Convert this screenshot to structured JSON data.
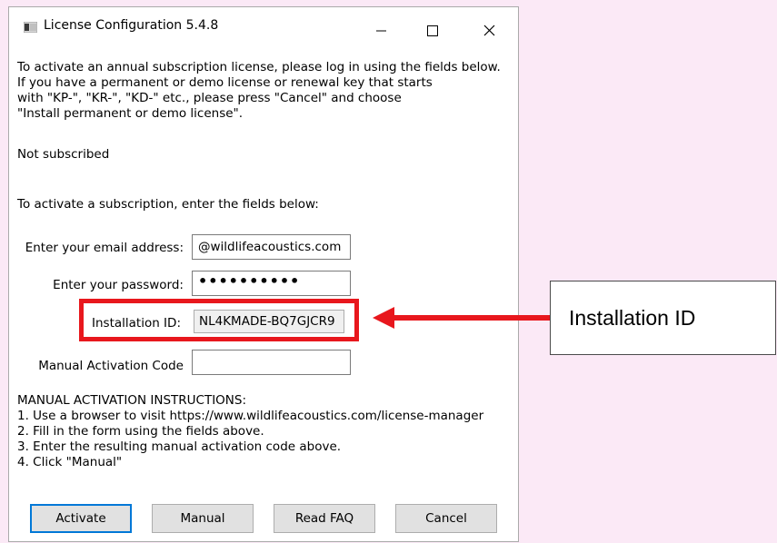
{
  "window": {
    "title": "License Configuration 5.4.8",
    "intro_lines": [
      "To activate an annual subscription license, please log in using the fields below.",
      "If you have a permanent or demo license or renewal key that starts",
      "with \"KP-\", \"KR-\", \"KD-\" etc., please press \"Cancel\" and choose",
      "\"Install permanent or demo license\"."
    ],
    "status": "Not subscribed",
    "subscription_prompt": "To activate a subscription, enter the fields below:"
  },
  "form": {
    "email_label": "Enter your email address:",
    "email_value": "@wildlifeacoustics.com",
    "password_label": "Enter your password:",
    "password_value": "••••••••••",
    "installation_id_label": "Installation ID:",
    "installation_id_value": "NL4KMADE-BQ7GJCR9",
    "manual_code_label": "Manual Activation Code",
    "manual_code_value": ""
  },
  "instructions": {
    "heading": "MANUAL ACTIVATION INSTRUCTIONS:",
    "steps": [
      "1. Use a browser to visit https://www.wildlifeacoustics.com/license-manager",
      "2. Fill in the form using the fields above.",
      "3. Enter the resulting manual activation code above.",
      "4. Click \"Manual\""
    ]
  },
  "buttons": {
    "activate": "Activate",
    "manual": "Manual",
    "read_faq": "Read FAQ",
    "cancel": "Cancel"
  },
  "annotation": {
    "callout_text": "Installation ID",
    "color": "#e8171d"
  }
}
